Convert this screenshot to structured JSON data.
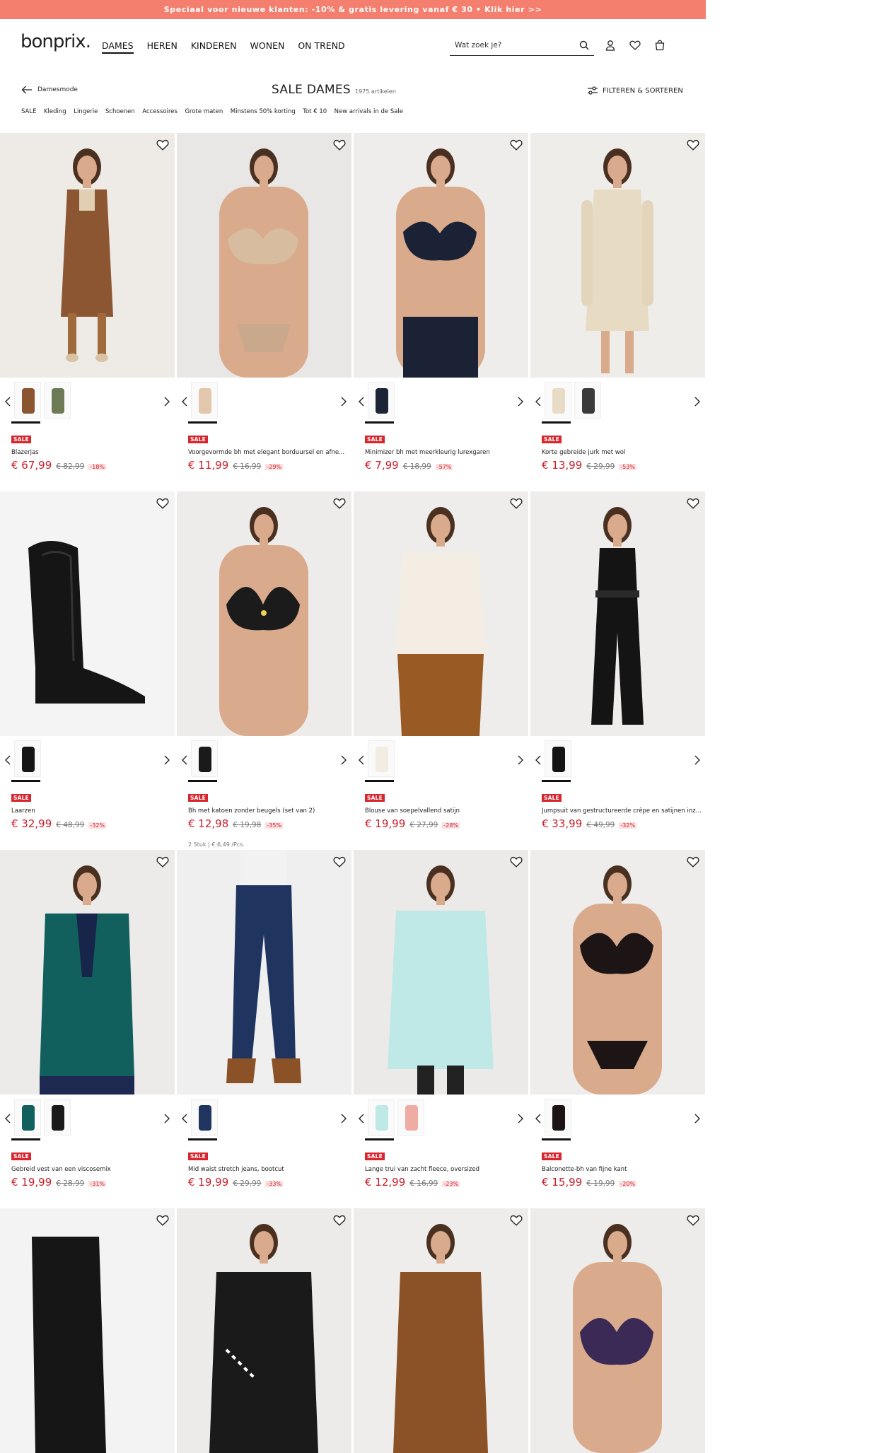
{
  "promo": {
    "text": "Speciaal voor nieuwe klanten: -10% & gratis levering vanaf € 30 • Klik hier >>"
  },
  "header": {
    "logo": "bonprix.",
    "nav": [
      "DAMES",
      "HEREN",
      "KINDEREN",
      "WONEN",
      "ON TREND"
    ],
    "search_placeholder": "Wat zoek je?"
  },
  "subheader": {
    "back_label": "Damesmode",
    "title": "SALE DAMES",
    "count": "1975 artikelen",
    "filter_label": "FILTEREN & SORTEREN"
  },
  "categories": [
    "SALE",
    "Kleding",
    "Lingerie",
    "Schoenen",
    "Accessoires",
    "Grote maten",
    "Minstens 50% korting",
    "Tot € 10",
    "New arrivals in de Sale"
  ],
  "sale_badge": "SALE",
  "products": [
    {
      "name": "Blazerjas",
      "price": "€ 67,99",
      "old": "€ 82,99",
      "disc": "-18%",
      "extra": "",
      "img": "coat",
      "bg": "#eeeae6",
      "swatches": [
        "#8a5530",
        "#6e7a55"
      ]
    },
    {
      "name": "Voorgevormde bh met elegant borduursel en afne...",
      "price": "€ 11,99",
      "old": "€ 16,99",
      "disc": "-29%",
      "extra": "",
      "img": "bra-beige",
      "bg": "#e9e7e6",
      "swatches": [
        "#e2c7ad"
      ]
    },
    {
      "name": "Minimizer bh met meerkleurig lurexgaren",
      "price": "€ 7,99",
      "old": "€ 18,99",
      "disc": "-57%",
      "extra": "",
      "img": "bra-navy",
      "bg": "#eeedeb",
      "swatches": [
        "#1d2436"
      ]
    },
    {
      "name": "Korte gebreide jurk met wol",
      "price": "€ 13,99",
      "old": "€ 29,99",
      "disc": "-53%",
      "extra": "",
      "img": "dress",
      "bg": "#efedea",
      "swatches": [
        "#e8dcc6",
        "#3a3a3a"
      ]
    },
    {
      "name": "Laarzen",
      "price": "€ 32,99",
      "old": "€ 48,99",
      "disc": "-32%",
      "extra": "",
      "img": "boot",
      "bg": "#f4f4f4",
      "swatches": [
        "#151515"
      ]
    },
    {
      "name": "Bh met katoen zonder beugels (set van 2)",
      "price": "€ 12,98",
      "old": "€ 19,98",
      "disc": "-35%",
      "extra": "2 Stuk | € 6,49 /Pcs.",
      "img": "bra-black",
      "bg": "#eeeceb",
      "swatches": [
        "#1a1a1a"
      ]
    },
    {
      "name": "Blouse van soepelvallend satijn",
      "price": "€ 19,99",
      "old": "€ 27,99",
      "disc": "-28%",
      "extra": "",
      "img": "blouse",
      "bg": "#efedeb",
      "swatches": [
        "#f2ece2"
      ]
    },
    {
      "name": "Jumpsuit van gestructureerde crêpe en satijnen inz...",
      "price": "€ 33,99",
      "old": "€ 49,99",
      "disc": "-32%",
      "extra": "",
      "img": "jumpsuit",
      "bg": "#eeedec",
      "swatches": [
        "#141414"
      ]
    },
    {
      "name": "Gebreid vest van een viscosemix",
      "price": "€ 19,99",
      "old": "€ 28,99",
      "disc": "-31%",
      "extra": "",
      "img": "cardigan",
      "bg": "#ecebea",
      "swatches": [
        "#11605e",
        "#1a1a1a"
      ]
    },
    {
      "name": "Mid waist stretch jeans, bootcut",
      "price": "€ 19,99",
      "old": "€ 29,99",
      "disc": "-33%",
      "extra": "",
      "img": "jeans",
      "bg": "#efefef",
      "swatches": [
        "#1f3560"
      ]
    },
    {
      "name": "Lange trui van zacht fleece, oversized",
      "price": "€ 12,99",
      "old": "€ 16,99",
      "disc": "-23%",
      "extra": "",
      "img": "fleece",
      "bg": "#eceae8",
      "swatches": [
        "#bfe9e6",
        "#eeaca2"
      ]
    },
    {
      "name": "Balconette-bh van fijne kant",
      "price": "€ 15,99",
      "old": "€ 19,99",
      "disc": "-20%",
      "extra": "",
      "img": "bra-lace",
      "bg": "#eeedeb",
      "swatches": [
        "#1d1416"
      ]
    },
    {
      "name": "",
      "price": "",
      "old": "",
      "disc": "",
      "extra": "",
      "img": "boot2",
      "bg": "#f3f3f3",
      "swatches": []
    },
    {
      "name": "",
      "price": "",
      "old": "",
      "disc": "",
      "extra": "",
      "img": "sweater",
      "bg": "#ecebea",
      "swatches": []
    },
    {
      "name": "",
      "price": "",
      "old": "",
      "disc": "",
      "extra": "",
      "img": "brown-top",
      "bg": "#efedeb",
      "swatches": []
    },
    {
      "name": "",
      "price": "",
      "old": "",
      "disc": "",
      "extra": "",
      "img": "bra-purple",
      "bg": "#eeecea",
      "swatches": []
    }
  ]
}
